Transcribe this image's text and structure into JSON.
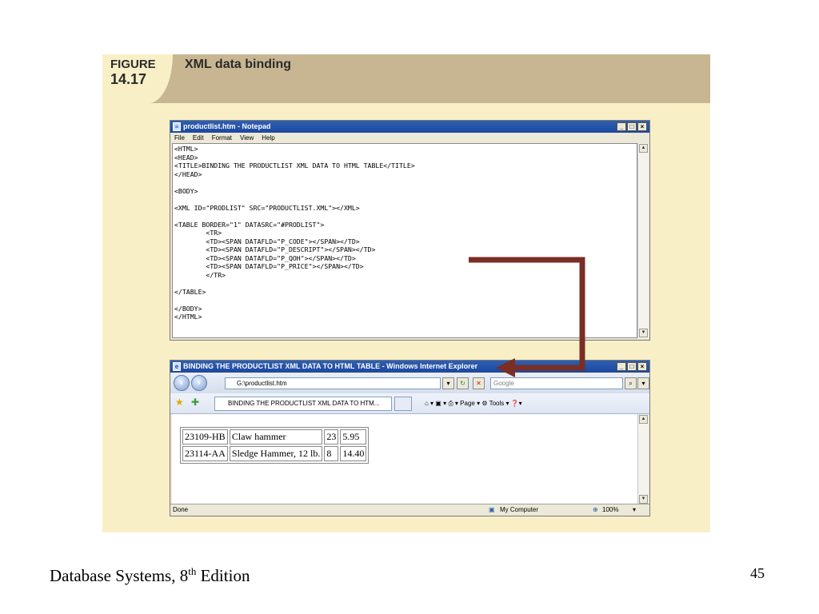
{
  "figure": {
    "label": "FIGURE",
    "number": "14.17",
    "title": "XML data binding"
  },
  "notepad": {
    "title": "productlist.htm - Notepad",
    "menu": [
      "File",
      "Edit",
      "Format",
      "View",
      "Help"
    ],
    "code": "<HTML>\n<HEAD>\n<TITLE>BINDING THE PRODUCTLIST XML DATA TO HTML TABLE</TITLE>\n</HEAD>\n\n<BODY>\n\n<XML ID=\"PRODLIST\" SRC=\"PRODUCTLIST.XML\"></XML>\n\n<TABLE BORDER=\"1\" DATASRC=\"#PRODLIST\">\n        <TR>\n        <TD><SPAN DATAFLD=\"P_CODE\"></SPAN></TD>\n        <TD><SPAN DATAFLD=\"P_DESCRIPT\"></SPAN></TD>\n        <TD><SPAN DATAFLD=\"P_QOH\"></SPAN></TD>\n        <TD><SPAN DATAFLD=\"P_PRICE\"></SPAN></TD>\n        </TR>\n\n</TABLE>\n\n</BODY>\n</HTML>",
    "window_buttons": [
      "_",
      "□",
      "×"
    ]
  },
  "browser": {
    "title": "BINDING THE PRODUCTLIST XML DATA TO HTML TABLE - Windows Internet Explorer",
    "address": "G:\\productlist.htm",
    "search_placeholder": "Google",
    "tab_label": "BINDING THE PRODUCTLIST XML DATA TO HTM...",
    "commands": "⌂ ▾  ▣ ▾  ⎙ ▾  Page ▾  ⚙ Tools ▾  ❓▾",
    "status_left": "Done",
    "zone": "My Computer",
    "zoom": "100%",
    "rows": [
      [
        "23109-HB",
        "Claw hammer",
        "23",
        "5.95"
      ],
      [
        "23114-AA",
        "Sledge Hammer, 12 lb.",
        "8",
        "14.40"
      ]
    ]
  },
  "colors": {
    "arrow": "#7a2e24",
    "panel": "#f9efc7",
    "header": "#c8b692"
  },
  "footer": {
    "book": "Database Systems, 8",
    "sup": "th",
    "edition": " Edition",
    "page": "45"
  }
}
